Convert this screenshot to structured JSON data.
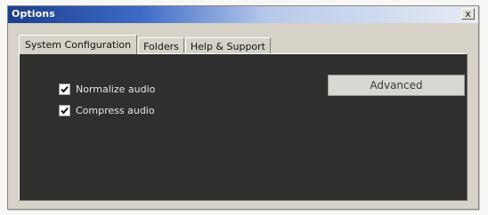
{
  "window": {
    "title": "Options",
    "close_glyph": "x"
  },
  "tabs": [
    {
      "label": "System Configuration",
      "active": true
    },
    {
      "label": "Folders",
      "active": false
    },
    {
      "label": "Help & Support",
      "active": false
    }
  ],
  "options": {
    "normalize": {
      "label": "Normalize audio",
      "checked": true
    },
    "compress": {
      "label": "Compress audio",
      "checked": true
    }
  },
  "buttons": {
    "advanced": "Advanced"
  },
  "colors": {
    "panel_background": "#2f2f2d",
    "titlebar_start": "#1c3f8c",
    "titlebar_end": "#e6ebf3"
  }
}
